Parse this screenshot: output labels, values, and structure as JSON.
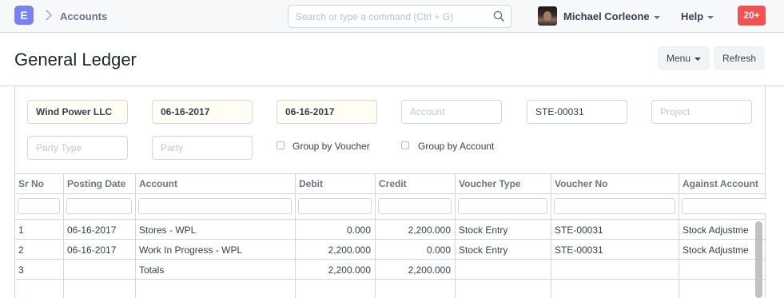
{
  "navbar": {
    "logo_letter": "E",
    "breadcrumb": "Accounts",
    "search_placeholder": "Search or type a command (Ctrl + G)",
    "user_name": "Michael Corleone",
    "help_label": "Help",
    "notification_count": "20+"
  },
  "page": {
    "title": "General Ledger",
    "menu_label": "Menu",
    "refresh_label": "Refresh"
  },
  "filters": {
    "company": "Wind Power LLC",
    "from_date": "06-16-2017",
    "to_date": "06-16-2017",
    "account_placeholder": "Account",
    "voucher_no": "STE-00031",
    "project_placeholder": "Project",
    "party_type_placeholder": "Party Type",
    "party_placeholder": "Party",
    "group_by_voucher": "Group by Voucher",
    "group_by_account": "Group by Account"
  },
  "grid": {
    "columns": [
      "Sr No",
      "Posting Date",
      "Account",
      "Debit",
      "Credit",
      "Voucher Type",
      "Voucher No",
      "Against Account"
    ],
    "rows": [
      [
        "1",
        "06-16-2017",
        "Stores - WPL",
        "0.000",
        "2,200.000",
        "Stock Entry",
        "STE-00031",
        "Stock Adjustme"
      ],
      [
        "2",
        "06-16-2017",
        "Work In Progress - WPL",
        "2,200.000",
        "0.000",
        "Stock Entry",
        "STE-00031",
        "Stock Adjustme"
      ],
      [
        "3",
        "",
        "Totals",
        "2,200.000",
        "2,200.000",
        "",
        "",
        ""
      ]
    ]
  }
}
